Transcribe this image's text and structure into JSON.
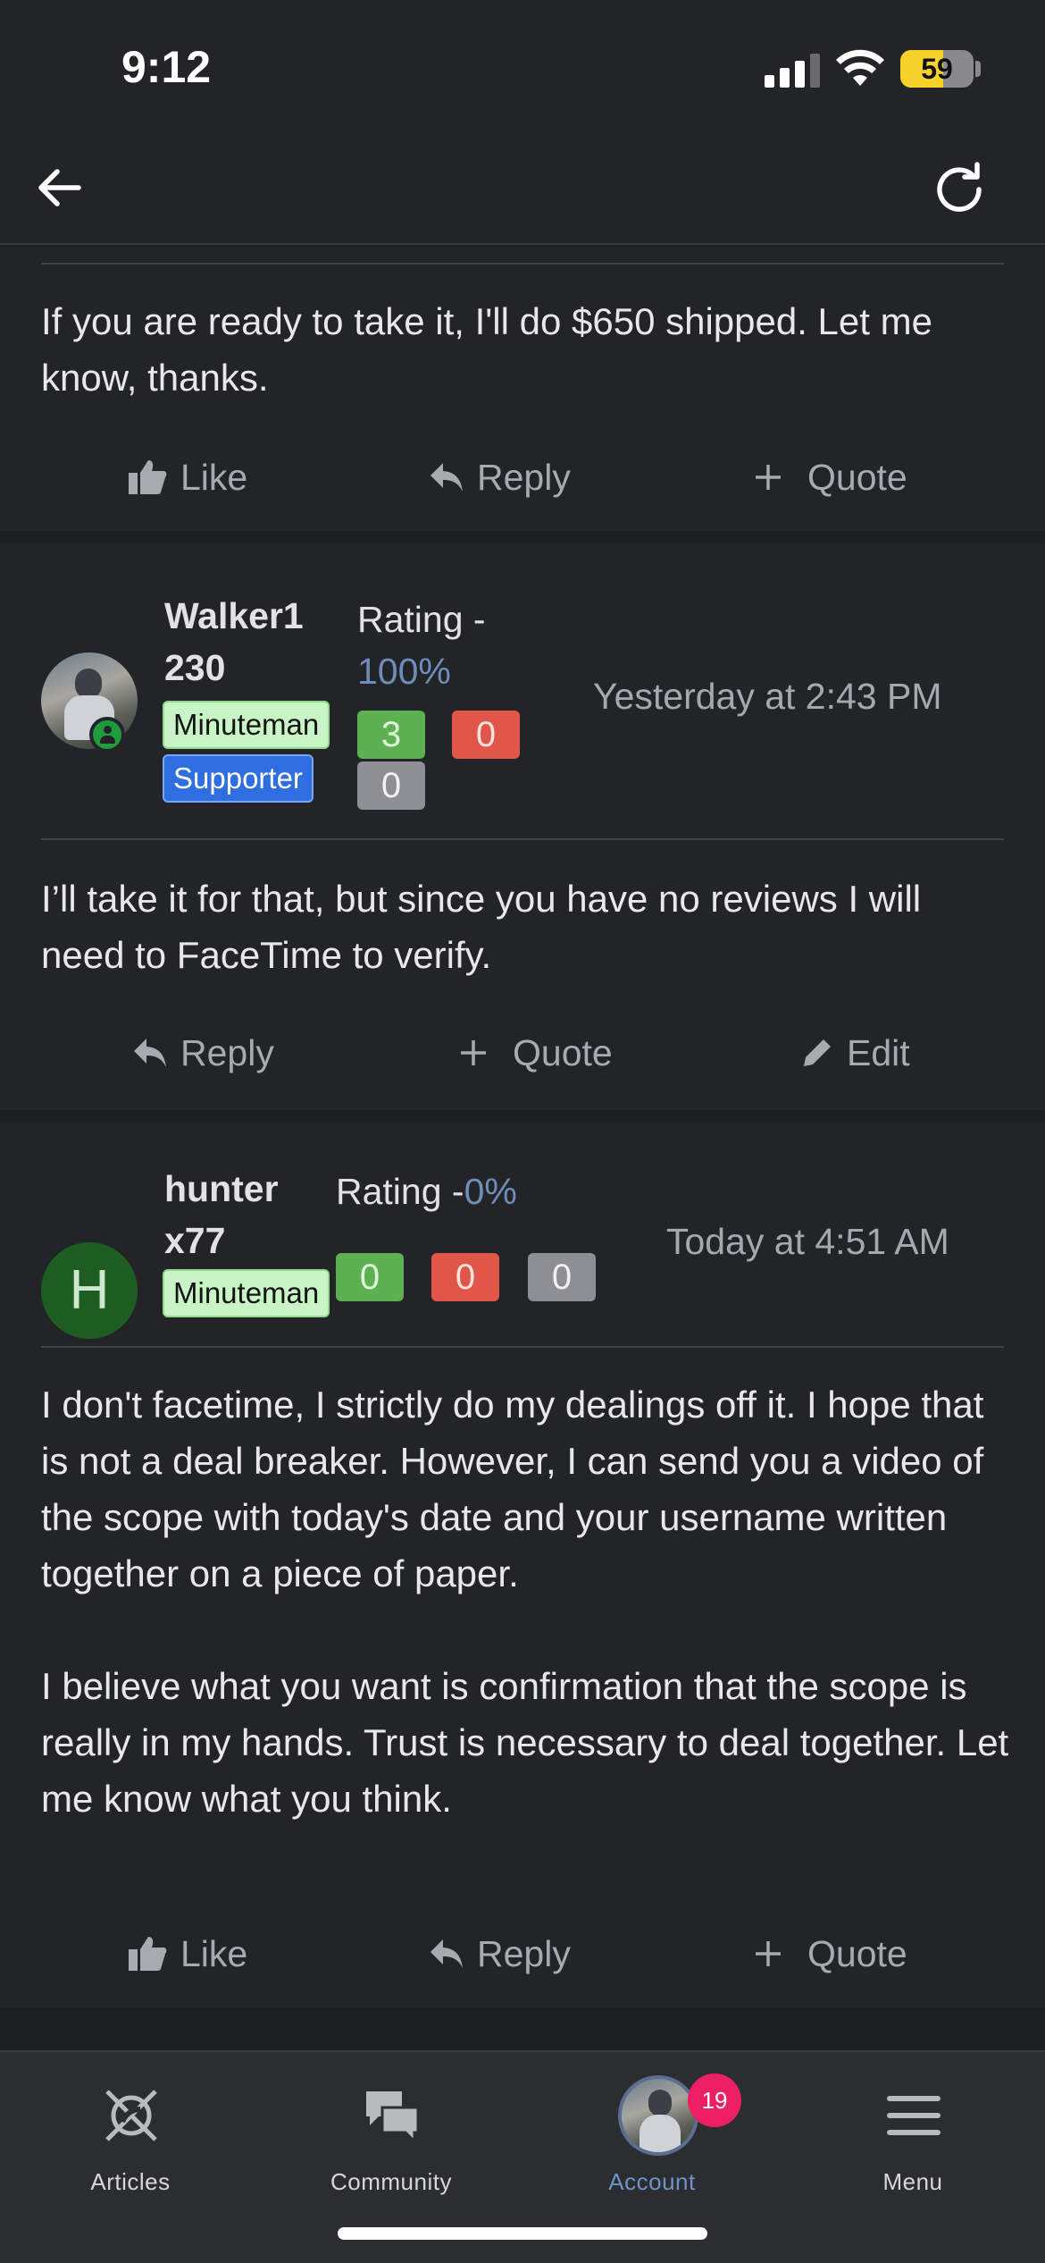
{
  "status_bar": {
    "time": "9:12",
    "battery": "59",
    "battery_level": 0.59
  },
  "posts": [
    {
      "body": "If you are ready to take it, I'll do $650 shipped. Let me know, thanks.",
      "actions": [
        "Like",
        "Reply",
        "Quote"
      ]
    },
    {
      "username_line1": "Walker1",
      "username_line2": "230",
      "badges": [
        "Minuteman",
        "Supporter"
      ],
      "rating_label": "Rating -",
      "rating_pct": "100%",
      "scores": {
        "positive": "3",
        "negative": "0",
        "neutral": "0"
      },
      "timestamp": "Yesterday at 2:43 PM",
      "body": "I’ll take it for that, but since you have no reviews I will need to FaceTime to verify.",
      "actions": [
        "Reply",
        "Quote",
        "Edit"
      ]
    },
    {
      "avatar_letter": "H",
      "username_line1": "hunter",
      "username_line2": "x77",
      "badges": [
        "Minuteman"
      ],
      "rating_label": "Rating -",
      "rating_pct": "0%",
      "scores": {
        "positive": "0",
        "negative": "0",
        "neutral": "0"
      },
      "timestamp": "Today at 4:51 AM",
      "body": "I don't facetime, I strictly do my dealings off it. I hope that is not a deal breaker. However, I can send you a video of the scope with today's date and your username written together on a piece of paper.\n\nI believe what you want is confirmation that the scope is really in my hands. Trust is necessary to deal together. Let me know what you think.",
      "actions": [
        "Like",
        "Reply",
        "Quote"
      ]
    }
  ],
  "tab_bar": {
    "tabs": [
      {
        "label": "Articles",
        "icon": "articles-logo-icon"
      },
      {
        "label": "Community",
        "icon": "chat-bubbles-icon"
      },
      {
        "label": "Account",
        "icon": "avatar",
        "badge": "19",
        "active": true
      },
      {
        "label": "Menu",
        "icon": "hamburger-icon"
      }
    ]
  },
  "colors": {
    "background": "#1d1e22",
    "card": "#232428",
    "accent_blue": "#6f93c7",
    "positive": "#5eb152",
    "negative": "#e0574a",
    "neutral": "#8e8f94",
    "notification": "#ec1f64"
  }
}
